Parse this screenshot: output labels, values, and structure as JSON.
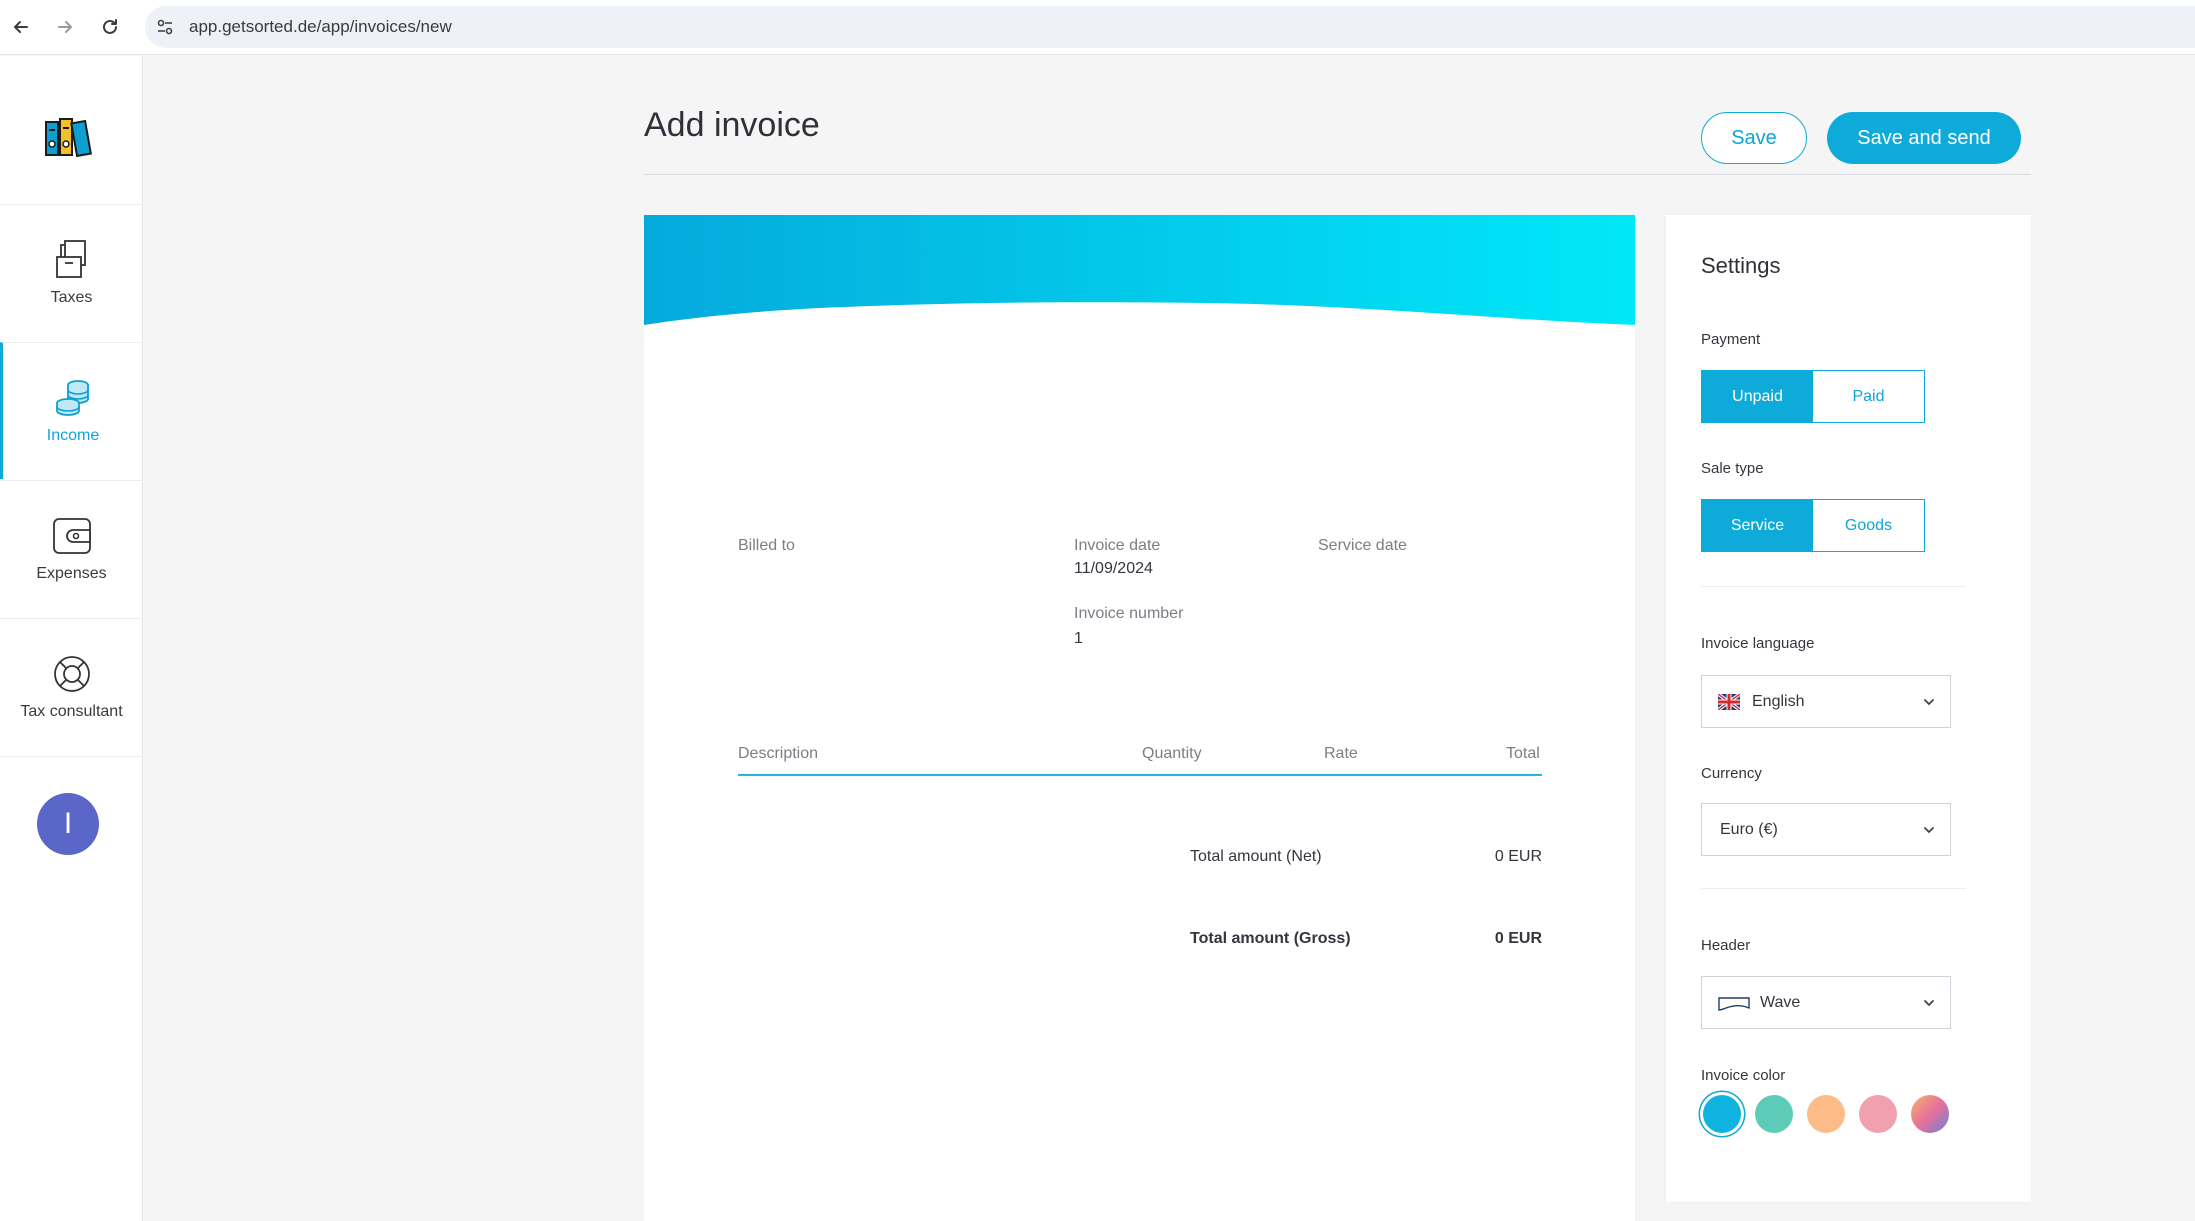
{
  "browser": {
    "url": "app.getsorted.de/app/invoices/new"
  },
  "sidebar": {
    "items": [
      {
        "label": "Taxes",
        "icon": "taxes-icon"
      },
      {
        "label": "Income",
        "icon": "income-coins-icon",
        "active": true
      },
      {
        "label": "Expenses",
        "icon": "wallet-icon"
      },
      {
        "label": "Tax consultant",
        "icon": "lifebuoy-icon"
      }
    ],
    "avatar_initial": "I"
  },
  "header": {
    "title": "Add invoice",
    "save_label": "Save",
    "save_send_label": "Save and send"
  },
  "invoice": {
    "billed_to_label": "Billed to",
    "invoice_date_label": "Invoice date",
    "invoice_date_value": "11/09/2024",
    "service_date_label": "Service date",
    "invoice_number_label": "Invoice number",
    "invoice_number_value": "1",
    "columns": [
      "Description",
      "Quantity",
      "Rate",
      "Total"
    ],
    "net_label": "Total amount (Net)",
    "net_value": "0 EUR",
    "gross_label": "Total amount (Gross)",
    "gross_value": "0 EUR"
  },
  "settings": {
    "title": "Settings",
    "payment_label": "Payment",
    "payment_options": [
      "Unpaid",
      "Paid"
    ],
    "payment_selected": "Unpaid",
    "sale_type_label": "Sale type",
    "sale_type_options": [
      "Service",
      "Goods"
    ],
    "sale_type_selected": "Service",
    "language_label": "Invoice language",
    "language_value": "English",
    "currency_label": "Currency",
    "currency_value": "Euro (€)",
    "header_label": "Header",
    "header_value": "Wave",
    "color_label": "Invoice color",
    "colors": [
      "#0eb3e0",
      "#5ccbb8",
      "#fdbb88",
      "#f0a0ae",
      "gradient"
    ],
    "selected_color": "#0eb3e0"
  },
  "colors": {
    "accent": "#0eaad9",
    "avatar": "#5a67c9"
  }
}
